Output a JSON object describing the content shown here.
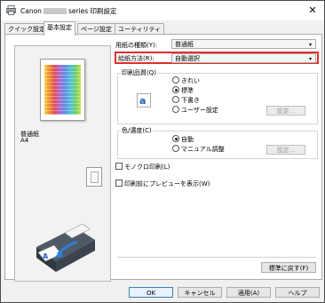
{
  "window": {
    "title_prefix": "Canon",
    "title_suffix": "series 印刷設定",
    "close_symbol": "✕"
  },
  "tabs": [
    "クイック設定",
    "基本設定",
    "ページ設定",
    "ユーティリティ"
  ],
  "preview": {
    "media_name": "普通紙",
    "media_size": "A4"
  },
  "fields": {
    "media_type_label": "用紙の種類(Y):",
    "media_type_value": "普通紙",
    "paper_source_label": "給紙方法(R):",
    "paper_source_value": "自動選択"
  },
  "print_quality": {
    "title": "印刷品質(Q)",
    "options": [
      "きれい",
      "標準",
      "下書き",
      "ユーザー設定"
    ],
    "selected_index": 1,
    "settings_button": "設定..."
  },
  "color_intensity": {
    "title": "色/濃度(C)",
    "options": [
      "自動",
      "マニュアル調整"
    ],
    "selected_index": 0,
    "settings_button": "設定..."
  },
  "checkboxes": {
    "grayscale": "モノクロ印刷(L)",
    "preview_before": "印刷前にプレビューを表示(W)"
  },
  "buttons": {
    "defaults": "標準に戻す(F)",
    "ok": "OK",
    "cancel": "キャンセル",
    "apply": "適用(A)",
    "help": "ヘルプ"
  },
  "colors": {
    "highlight": "#e0302a"
  }
}
